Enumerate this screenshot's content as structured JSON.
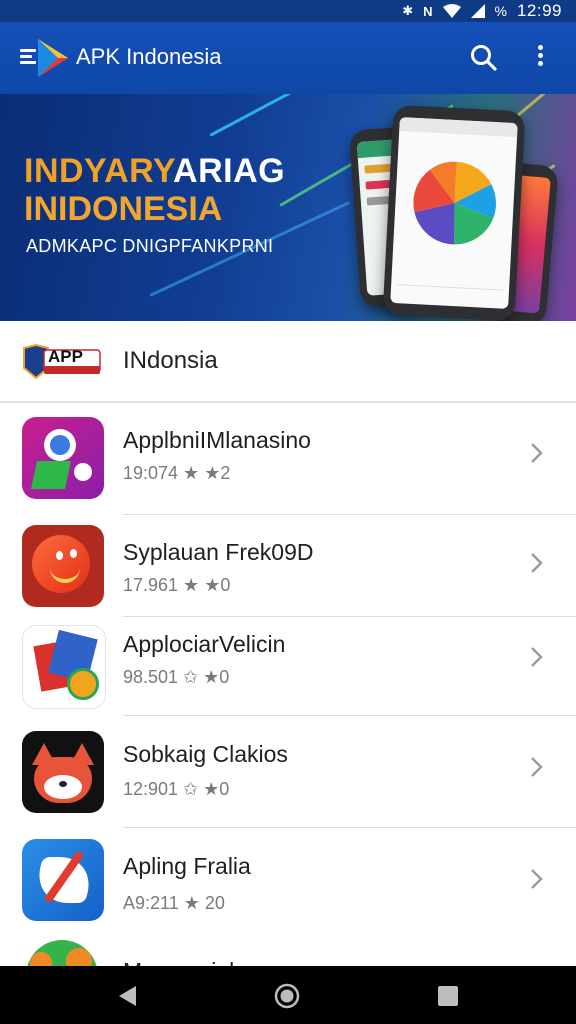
{
  "status_bar": {
    "time": "12:99",
    "battery": "%",
    "icons": [
      "bluetooth-icon",
      "nfc-icon",
      "wifi-icon",
      "signal-icon",
      "battery-icon"
    ]
  },
  "app_bar": {
    "title": "APK Indonesia",
    "icons": [
      "menu-icon",
      "play-logo-icon",
      "search-icon",
      "more-vert-icon"
    ]
  },
  "banner": {
    "line1_part1": "INDYARY",
    "line1_part2": "ARIAG",
    "line2": "INIDONESIA",
    "line3": "ADMKAPC DNIGPFANKPRNI"
  },
  "category": {
    "logo_text": "APP",
    "title": "INdonsia"
  },
  "apps": [
    {
      "name": "ApplbniIMlanasino",
      "meta": "19:074 ★ ★2",
      "icon": "pink-map-app-icon"
    },
    {
      "name": "Syplauan Frek09D",
      "meta": "17.961 ★ ★0",
      "icon": "red-smiley-app-icon"
    },
    {
      "name": "ApplociarVelicin",
      "meta": "98.501 ✩ ★0",
      "icon": "red-blue-app-icon"
    },
    {
      "name": "Sobkaig Clakios",
      "meta": "12:901 ✩ ★0",
      "icon": "fox-app-icon"
    },
    {
      "name": "Apling Fralia",
      "meta": "A9:211 ★ 20",
      "icon": "blue-brush-app-icon"
    },
    {
      "name": "Mameaciak",
      "meta": "",
      "icon": "green-gear-app-icon"
    }
  ],
  "colors": {
    "app_bar": "#1550b8",
    "status_bar": "#0e3a86",
    "banner_orange": "#f0a128",
    "nav_bar": "#000000"
  },
  "nav_bar": {
    "icons": [
      "back-icon",
      "home-icon",
      "recent-apps-icon"
    ]
  }
}
